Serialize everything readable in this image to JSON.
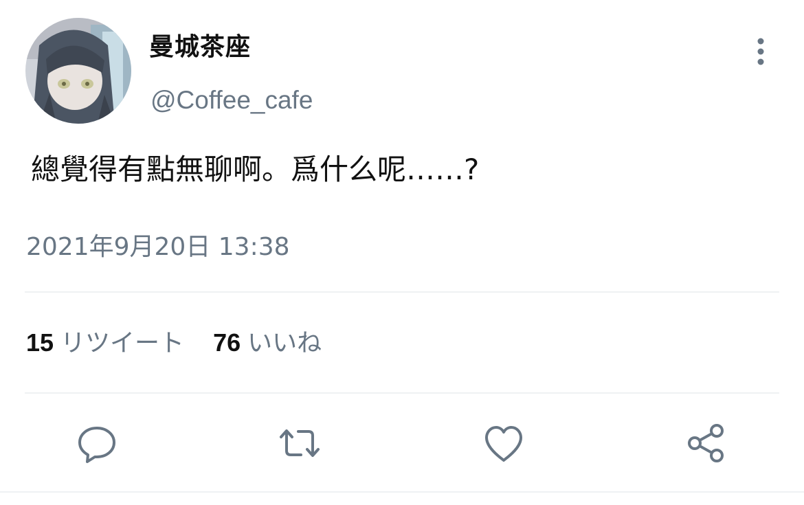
{
  "tweet": {
    "display_name": "曼城茶座",
    "handle": "@Coffee_cafe",
    "text": "總覺得有點無聊啊。爲什么呢……?",
    "timestamp": "2021年9月20日 13:38"
  },
  "stats": {
    "retweet_count": "15",
    "retweet_label": "リツイート",
    "like_count": "76",
    "like_label": "いいね"
  },
  "actions": {
    "icons": [
      "comment-icon",
      "retweet-icon",
      "like-icon",
      "share-icon"
    ]
  },
  "colors": {
    "text_primary": "#111111",
    "text_secondary": "#687684",
    "icon": "#687684",
    "divider": "#eff1f3"
  }
}
